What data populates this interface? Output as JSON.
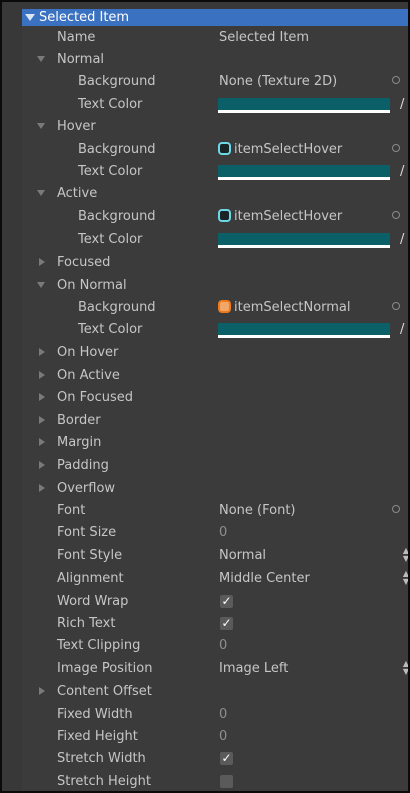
{
  "header": {
    "title": "Selected Item"
  },
  "rows": {
    "name": {
      "label": "Name",
      "value": "Selected Item"
    },
    "normal": {
      "label": "Normal"
    },
    "normal_bg": {
      "label": "Background",
      "value": "None (Texture 2D)"
    },
    "normal_tc": {
      "label": "Text Color"
    },
    "hover": {
      "label": "Hover"
    },
    "hover_bg": {
      "label": "Background",
      "value": "itemSelectHover"
    },
    "hover_tc": {
      "label": "Text Color"
    },
    "active": {
      "label": "Active"
    },
    "active_bg": {
      "label": "Background",
      "value": "itemSelectHover"
    },
    "active_tc": {
      "label": "Text Color"
    },
    "focused": {
      "label": "Focused"
    },
    "onnormal": {
      "label": "On Normal"
    },
    "onnormal_bg": {
      "label": "Background",
      "value": "itemSelectNormal"
    },
    "onnormal_tc": {
      "label": "Text Color"
    },
    "onhover": {
      "label": "On Hover"
    },
    "onactive": {
      "label": "On Active"
    },
    "onfocused": {
      "label": "On Focused"
    },
    "border": {
      "label": "Border"
    },
    "margin": {
      "label": "Margin"
    },
    "padding": {
      "label": "Padding"
    },
    "overflow": {
      "label": "Overflow"
    },
    "font": {
      "label": "Font",
      "value": "None (Font)"
    },
    "fontsize": {
      "label": "Font Size",
      "value": "0"
    },
    "fontstyle": {
      "label": "Font Style",
      "value": "Normal"
    },
    "alignment": {
      "label": "Alignment",
      "value": "Middle Center"
    },
    "wordwrap": {
      "label": "Word Wrap",
      "checked": true
    },
    "richtext": {
      "label": "Rich Text",
      "checked": true
    },
    "textclip": {
      "label": "Text Clipping",
      "value": "0"
    },
    "imagepos": {
      "label": "Image Position",
      "value": "Image Left"
    },
    "contentoffset": {
      "label": "Content Offset"
    },
    "fixedwidth": {
      "label": "Fixed Width",
      "value": "0"
    },
    "fixedheight": {
      "label": "Fixed Height",
      "value": "0"
    },
    "stretchwidth": {
      "label": "Stretch Width",
      "checked": true
    },
    "stretchheight": {
      "label": "Stretch Height",
      "checked": false
    }
  },
  "colors": {
    "header": "#3a71c0",
    "panel": "#383838",
    "swatch": "#0b6068",
    "texture_cyan": "#6cd8e6",
    "texture_orange": "#f07a1a"
  },
  "icons": {
    "check": "✓",
    "eyedropper": "/",
    "updown": "⇕"
  }
}
